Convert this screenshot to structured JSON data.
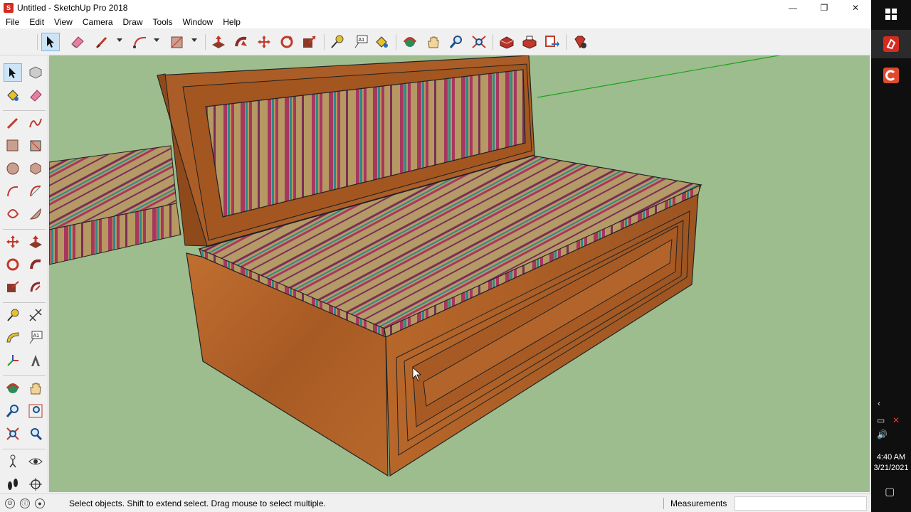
{
  "window": {
    "title": "Untitled - SketchUp Pro 2018",
    "app_icon": "sketchup-icon",
    "controls": {
      "minimize": "—",
      "maximize": "❐",
      "close": "✕"
    }
  },
  "menubar": {
    "items": [
      "File",
      "Edit",
      "View",
      "Camera",
      "Draw",
      "Tools",
      "Window",
      "Help"
    ]
  },
  "toolbar": {
    "tools": [
      "select-tool",
      "eraser-tool",
      "line-tool",
      "arc-tool",
      "rectangle-tool",
      "push-pull-tool",
      "follow-me-tool",
      "move-tool",
      "rotate-tool",
      "scale-tool",
      "tape-measure-tool",
      "text-tool",
      "paint-bucket-tool",
      "orbit-tool",
      "pan-tool",
      "zoom-tool",
      "zoom-extents-tool",
      "3d-warehouse-tool",
      "extension-warehouse-tool",
      "layout-send-tool",
      "extension-manager-tool"
    ],
    "text_tool_label": "A1"
  },
  "left_toolbar": {
    "text_tool_label": "A1"
  },
  "statusbar": {
    "hint": "Select objects. Shift to extend select. Drag mouse to select multiple.",
    "measurements_label": "Measurements",
    "measurements_value": ""
  },
  "taskbar": {
    "time": "4:40 AM",
    "date": "3/21/2021",
    "apps": [
      "windows-start-icon",
      "sketchup-taskbar-icon",
      "camtasia-taskbar-icon"
    ]
  },
  "colors": {
    "viewport_bg": "#9dbd8e",
    "wood": "#b5662a",
    "wood_dark": "#8f4a1c",
    "fabric": "#b59862",
    "stripe_pink": "#a8375e",
    "stripe_teal": "#2d8a8a",
    "green_axis": "#1aa11a",
    "selection": "#cce4f7",
    "taskbar": "#0f0f0f"
  }
}
